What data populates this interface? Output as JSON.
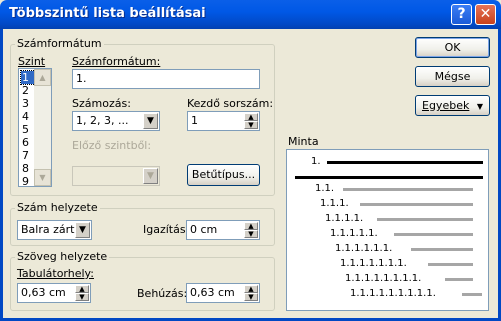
{
  "window": {
    "title": "Többszintű lista beállításai"
  },
  "titlebar": {
    "help_label": "?",
    "close_label": "✕"
  },
  "buttons": {
    "ok": "OK",
    "cancel": "Mégse",
    "more": "Egyebek",
    "font": "Betűtípus..."
  },
  "numfmt": {
    "group_label": "Számformátum",
    "level_label": "Szint",
    "levels": [
      "1",
      "2",
      "3",
      "4",
      "5",
      "6",
      "7",
      "8",
      "9"
    ],
    "selected_level": "1",
    "format_label": "Számformátum:",
    "format_value": "1.",
    "numbering_label": "Számozás:",
    "numbering_value": "1, 2, 3, ...",
    "start_label": "Kezdő sorszám:",
    "start_value": "1",
    "prev_level_label": "Előző szintből:"
  },
  "numpos": {
    "group_label": "Szám helyzete",
    "align_value": "Balra zárt",
    "indent_label": "Igazítás:",
    "indent_value": "0 cm"
  },
  "textpos": {
    "group_label": "Szöveg helyzete",
    "tab_label": "Tabulátorhely:",
    "tab_value": "0,63 cm",
    "indent_label": "Behúzás:",
    "indent_value": "0,63 cm"
  },
  "preview": {
    "label": "Minta",
    "rows": [
      "1.",
      "1.1.",
      "1.1.1.",
      "1.1.1.1.",
      "1.1.1.1.1.",
      "1.1.1.1.1.1.",
      "1.1.1.1.1.1.1.",
      "1.1.1.1.1.1.1.1.",
      "1.1.1.1.1.1.1.1.1."
    ]
  }
}
